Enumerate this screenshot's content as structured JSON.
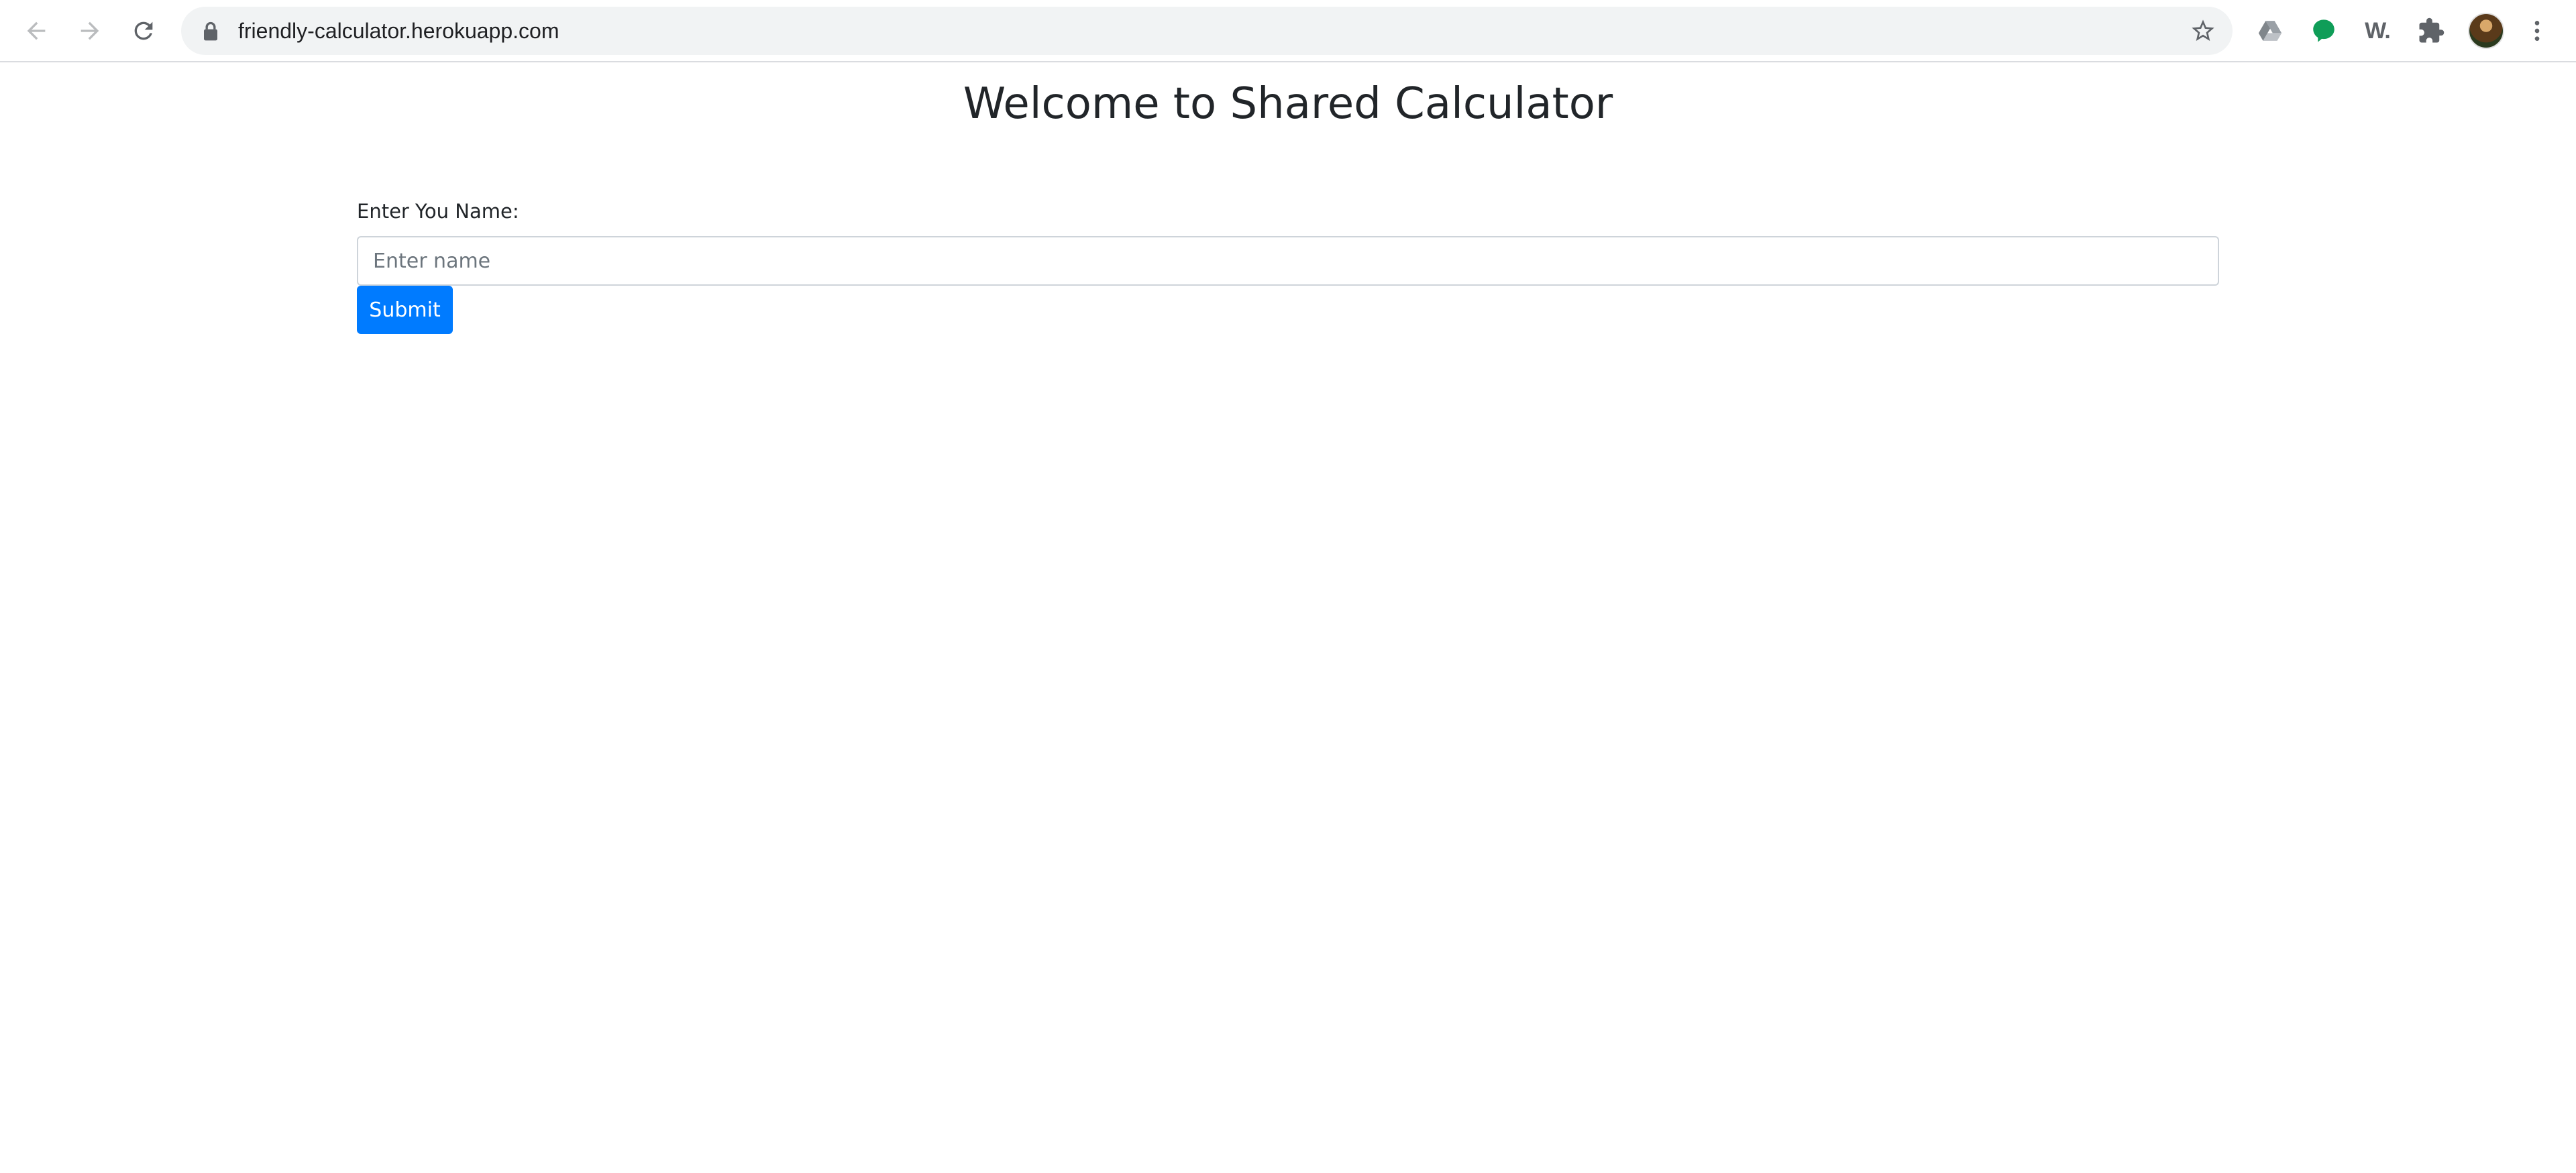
{
  "browser": {
    "url": "friendly-calculator.herokuapp.com",
    "nav_icons": [
      "back-icon",
      "forward-icon",
      "reload-icon"
    ],
    "omnibox_icons": [
      "lock-icon",
      "bookmark-star-icon"
    ],
    "extensions": [
      "google-drive-icon",
      "green-chat-icon",
      "w-extension-icon",
      "puzzle-extensions-icon",
      "profile-avatar",
      "kebab-menu-icon"
    ],
    "extension_w_label": "W.",
    "colors": {
      "green_ext": "#0f9d58",
      "icon_gray": "#5f6368"
    }
  },
  "page": {
    "title": "Welcome to Shared Calculator",
    "name_label": "Enter You Name:",
    "name_placeholder": "Enter name",
    "name_value": "",
    "submit_label": "Submit",
    "colors": {
      "primary": "#007bff",
      "text": "#212529"
    }
  }
}
